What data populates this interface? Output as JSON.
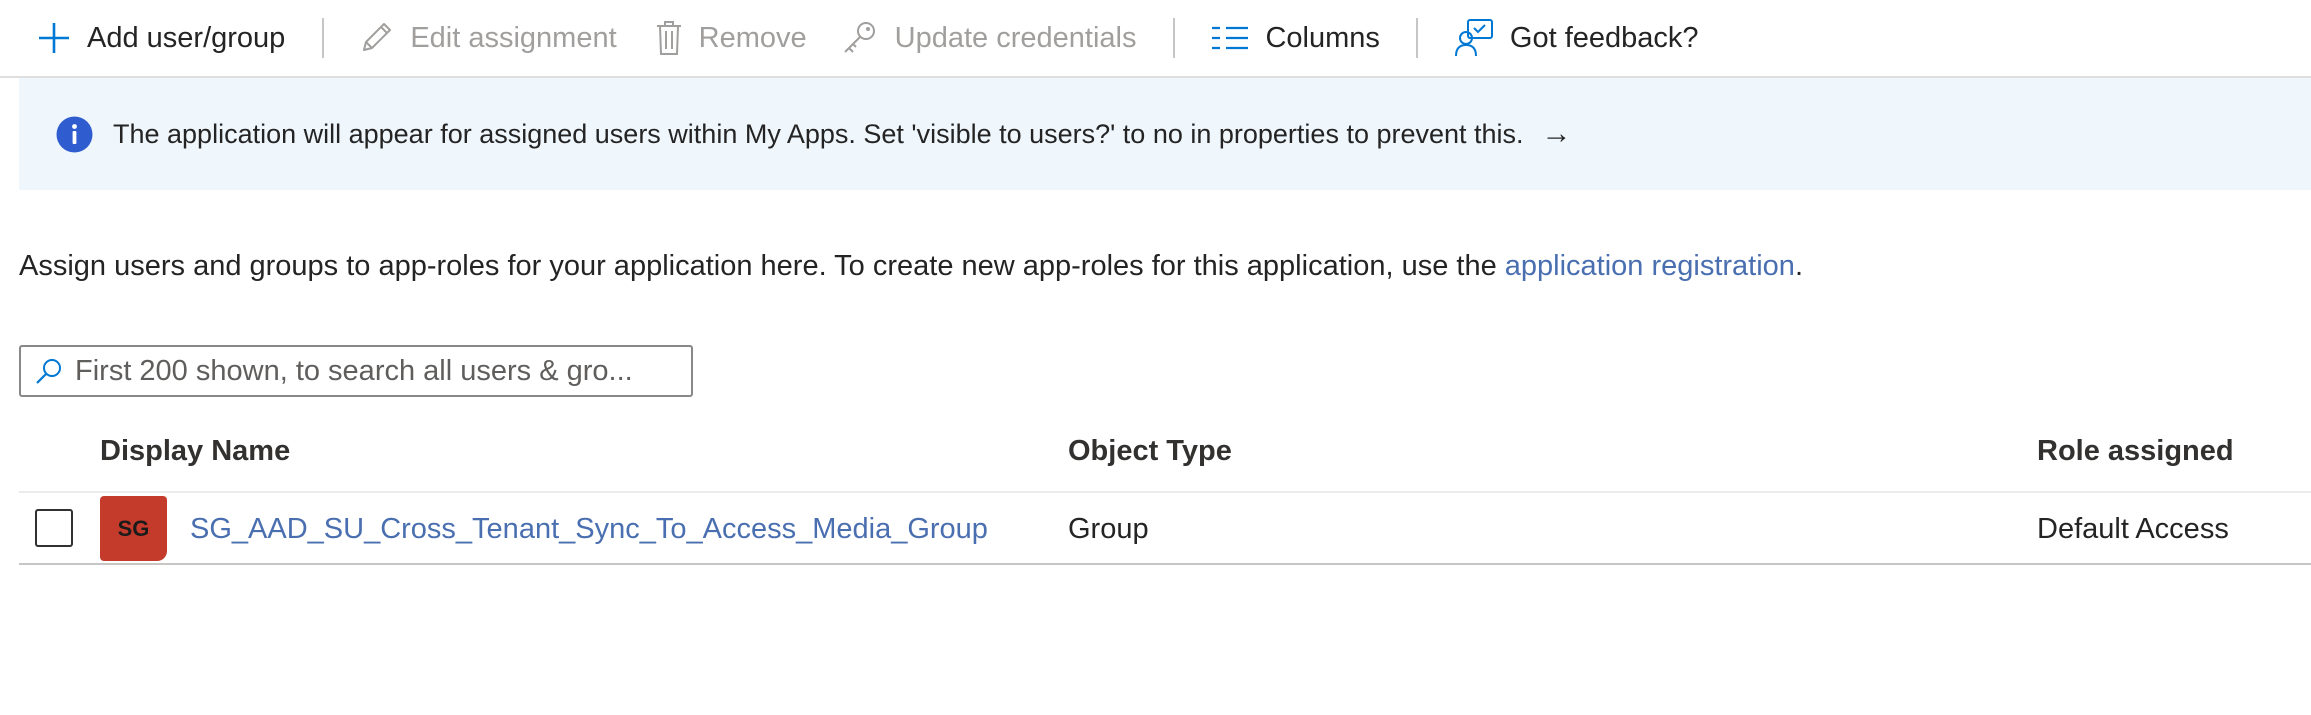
{
  "toolbar": {
    "add": "Add user/group",
    "edit": "Edit assignment",
    "remove": "Remove",
    "update": "Update credentials",
    "columns": "Columns",
    "feedback": "Got feedback?"
  },
  "banner": {
    "message": "The application will appear for assigned users within My Apps. Set 'visible to users?' to no in properties to prevent this.",
    "arrow": "→"
  },
  "description": {
    "text": "Assign users and groups to app-roles for your application here. To create new app-roles for this application, use the ",
    "link": "application registration",
    "end": "."
  },
  "search": {
    "placeholder": "First 200 shown, to search all users & gro..."
  },
  "table": {
    "headers": {
      "name": "Display Name",
      "type": "Object Type",
      "role": "Role assigned"
    },
    "rows": [
      {
        "initials": "SG",
        "name": "SG_AAD_SU_Cross_Tenant_Sync_To_Access_Media_Group",
        "type": "Group",
        "role": "Default Access"
      }
    ]
  },
  "colors": {
    "accent": "#0078d4",
    "link": "#4a6fb0",
    "banner_bg": "#eff6fc",
    "avatar": "#c43b2b",
    "disabled": "#a19f9d"
  }
}
